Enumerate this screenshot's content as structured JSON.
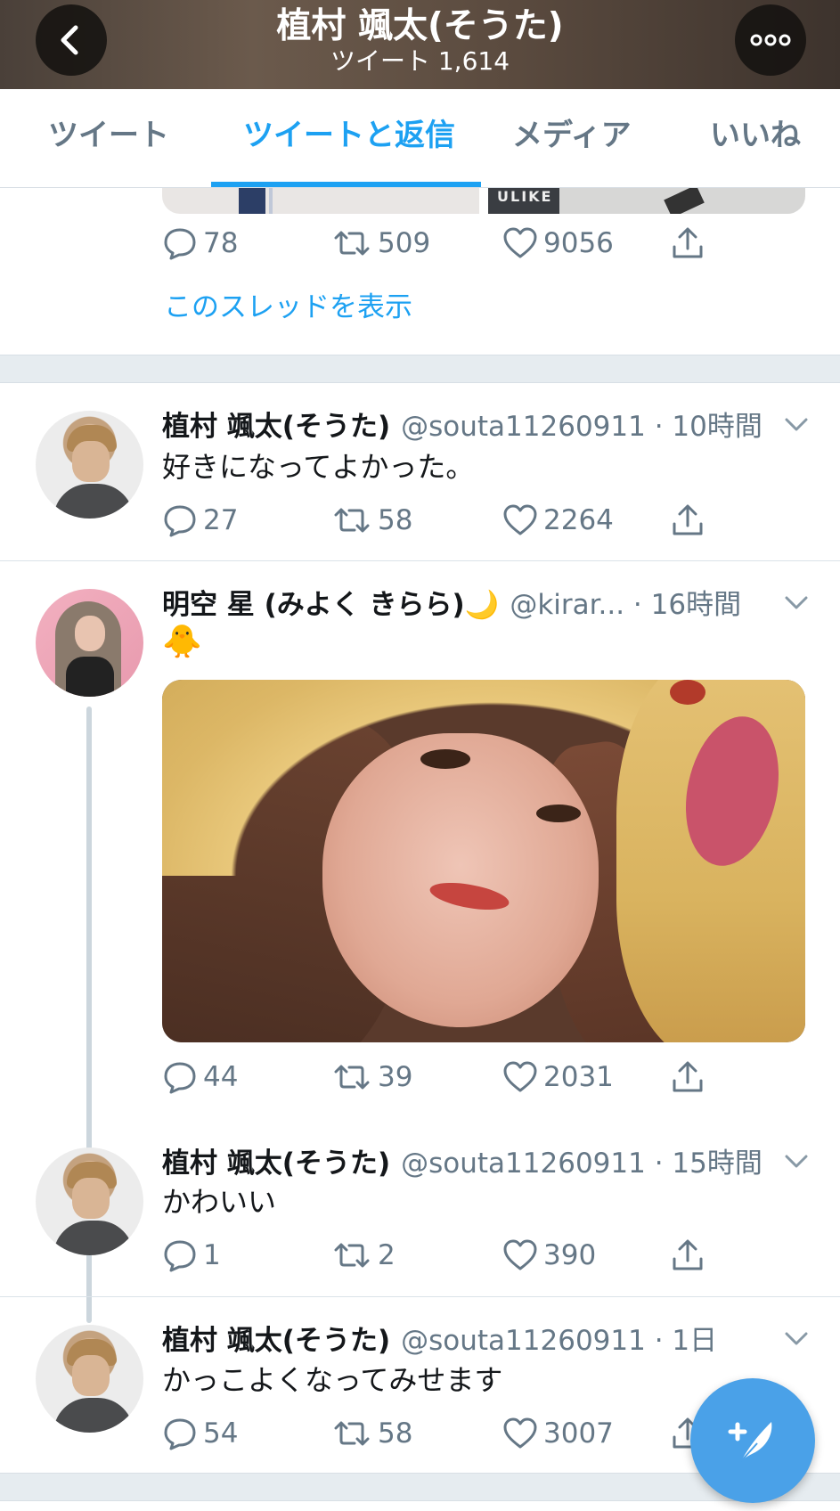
{
  "header": {
    "title": "植村 颯太(そうた)",
    "subtitle": "ツイート 1,614"
  },
  "tabs": [
    {
      "label": "ツイート",
      "active": false
    },
    {
      "label": "ツイートと返信",
      "active": true
    },
    {
      "label": "メディア",
      "active": false
    },
    {
      "label": "いいね",
      "active": false
    }
  ],
  "tweets": [
    {
      "replies": "78",
      "retweets": "509",
      "likes": "9056",
      "show_thread": "このスレッドを表示",
      "media_tag": "ULIKE"
    },
    {
      "name": "植村 颯太(そうた)",
      "handle": "@souta11260911 · 10時間",
      "text": "好きになってよかった。",
      "replies": "27",
      "retweets": "58",
      "likes": "2264"
    },
    {
      "name": "明空 星 (みよく きらら)🌙",
      "handle": "@kirar... · 16時間",
      "text": "🐥",
      "replies": "44",
      "retweets": "39",
      "likes": "2031"
    },
    {
      "name": "植村 颯太(そうた)",
      "handle": "@souta11260911 · 15時間",
      "text": "かわいい",
      "replies": "1",
      "retweets": "2",
      "likes": "390"
    },
    {
      "name": "植村 颯太(そうた)",
      "handle": "@souta11260911 · 1日",
      "text": "かっこよくなってみせます",
      "replies": "54",
      "retweets": "58",
      "likes": "3007"
    }
  ],
  "colors": {
    "accent": "#1da1f2",
    "muted": "#657786",
    "fab": "#4aa1e8"
  },
  "icons": [
    "back-arrow-icon",
    "more-icon",
    "reply-icon",
    "retweet-icon",
    "like-icon",
    "share-icon",
    "chevron-down-icon",
    "compose-icon"
  ]
}
